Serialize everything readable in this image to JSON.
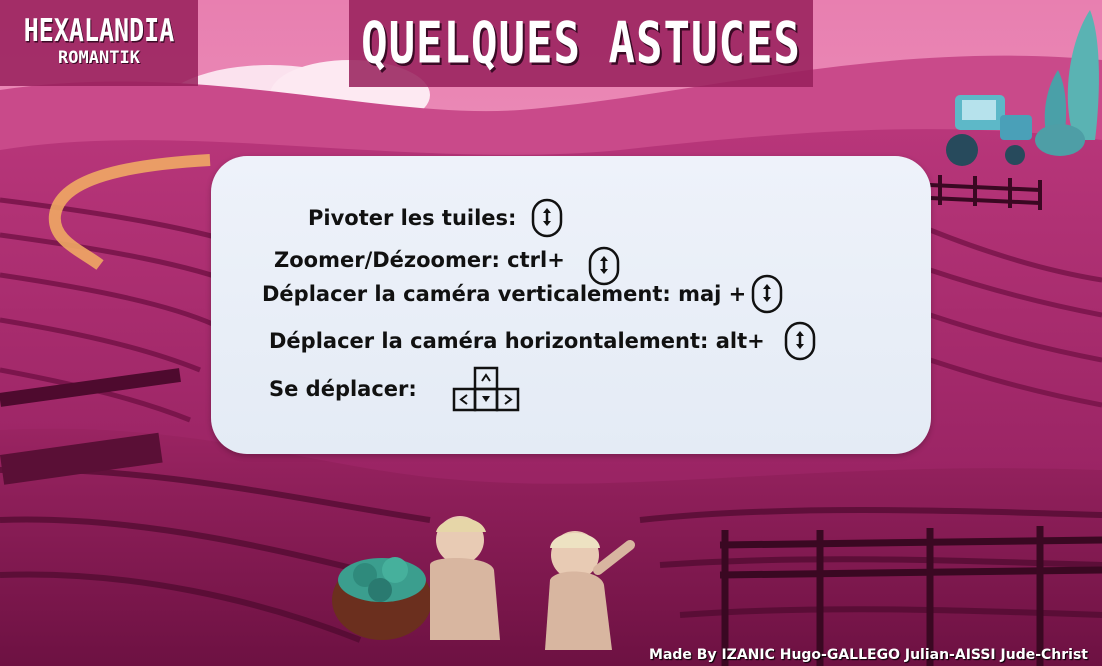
{
  "logo": {
    "line1": "HEXALANDIA",
    "line2": "ROMANTIK"
  },
  "header": {
    "title": "QUELQUES ASTUCES"
  },
  "tips": {
    "rotate": "Pivoter les tuiles:",
    "zoom": "Zoomer/Dézoomer: ctrl+",
    "camera_vertical": "Déplacer la caméra verticalement: maj +",
    "camera_horizontal": "Déplacer la caméra horizontalement: alt+",
    "move": "Se déplacer:"
  },
  "icons": {
    "mouse_scroll": "mouse-scroll-icon",
    "arrow_keys": "arrow-keys-icon"
  },
  "credits": "Made By IZANIC Hugo-GALLEGO Julian-AISSI Jude-Christ",
  "colors": {
    "banner": "#961e5a",
    "panel": "#eaf0f8",
    "text": "#111111"
  }
}
